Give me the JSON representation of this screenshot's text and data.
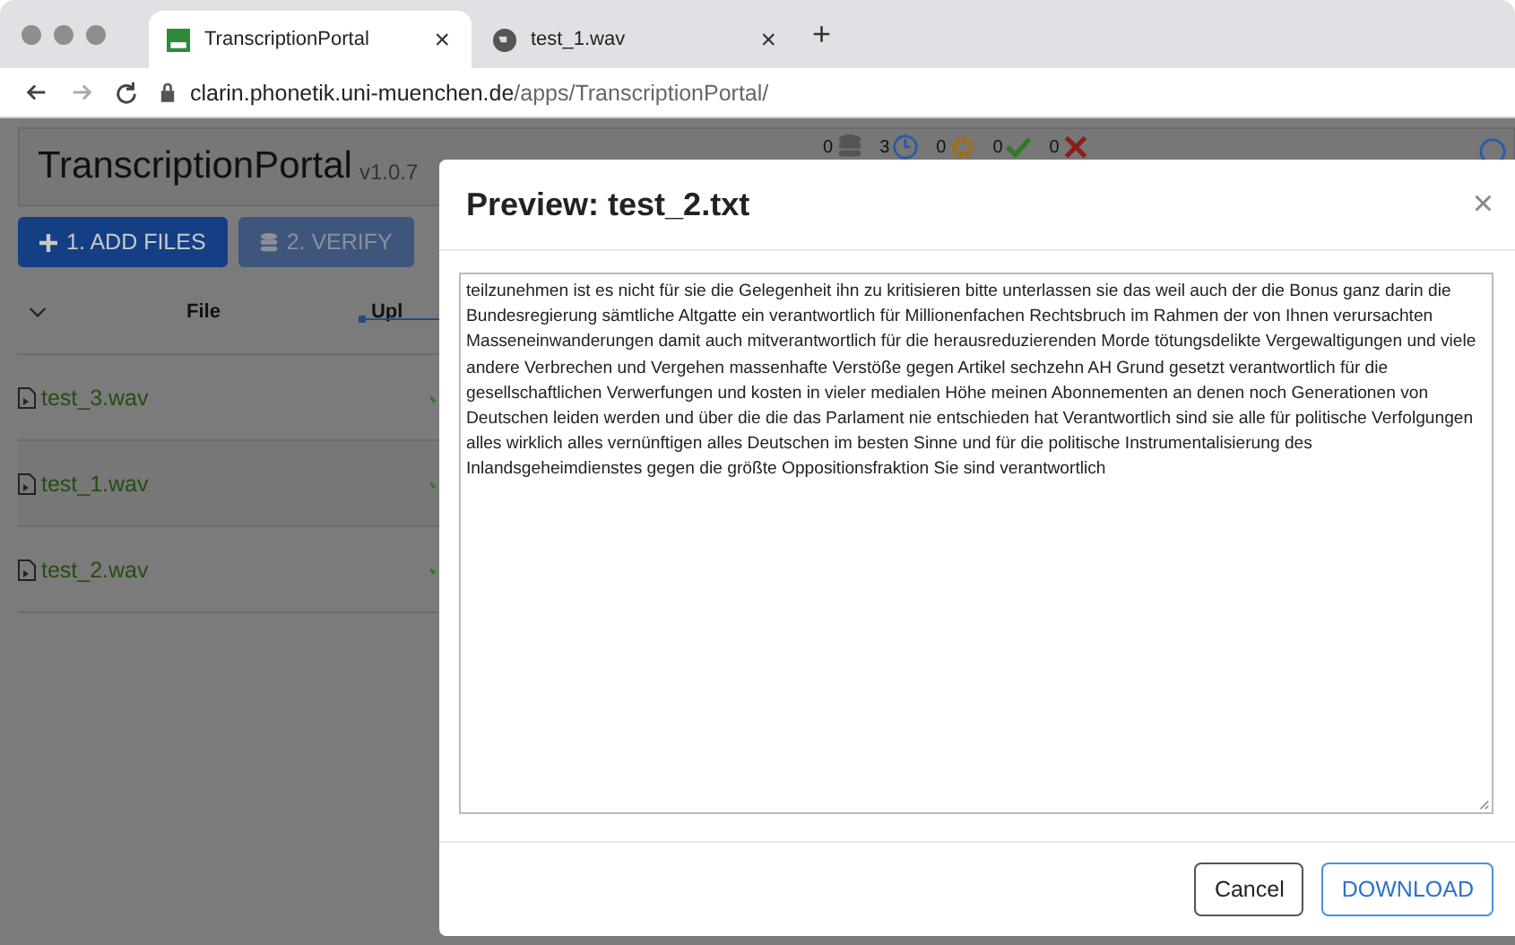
{
  "browser": {
    "tabs": [
      {
        "title": "TranscriptionPortal",
        "selected": true,
        "close": "×"
      },
      {
        "title": "test_1.wav",
        "selected": false,
        "close": "×"
      }
    ],
    "new_tab": "+",
    "address": {
      "host": "clarin.phonetik.uni-muenchen.de",
      "path": "/apps/TranscriptionPortal/"
    }
  },
  "app": {
    "title": "TranscriptionPortal",
    "version": "v1.0.7",
    "status": [
      {
        "count": "0",
        "kind": "database"
      },
      {
        "count": "3",
        "kind": "clock"
      },
      {
        "count": "0",
        "kind": "gear"
      },
      {
        "count": "0",
        "kind": "check"
      },
      {
        "count": "0",
        "kind": "cross"
      }
    ],
    "buttons": [
      {
        "label": "1. ADD FILES",
        "kind": "add",
        "disabled": false
      },
      {
        "label": "2. VERIFY",
        "kind": "verify",
        "disabled": true
      }
    ],
    "columns": [
      {
        "label": "File"
      },
      {
        "label": "Upl"
      }
    ],
    "files": [
      {
        "name": "test_3.wav",
        "uploaded": true
      },
      {
        "name": "test_1.wav",
        "uploaded": true
      },
      {
        "name": "test_2.wav",
        "uploaded": true
      }
    ]
  },
  "modal": {
    "title": "Preview: test_2.txt",
    "close": "×",
    "text": "teilzunehmen ist es nicht für sie die Gelegenheit ihn zu kritisieren bitte unterlassen sie das weil auch der die Bonus ganz darin die Bundesregierung sämtliche Altgatte ein verantwortlich für Millionenfachen Rechtsbruch im Rahmen der von Ihnen verursachten Masseneinwanderungen damit auch mitverantwortlich für die herausreduzierenden Morde tötungsdelikte Vergewaltigungen und viele andere Verbrechen und Vergehen massenhafte Verstöße gegen Artikel sechzehn AH Grund gesetzt verantwortlich für die gesellschaftlichen Verwerfungen und kosten in vieler medialen Höhe meinen Abonnementen an denen noch Generationen von Deutschen leiden werden und über die die das Parlament nie entschieden hat Verantwortlich sind sie alle für politische Verfolgungen alles wirklich alles vernünftigen alles Deutschen im besten Sinne und für die politische Instrumentalisierung des Inlandsgeheimdienstes gegen die größte Oppositionsfraktion Sie sind verantwortlich",
    "buttons": [
      {
        "label": "Cancel",
        "kind": "secondary"
      },
      {
        "label": "DOWNLOAD",
        "kind": "primary"
      }
    ]
  }
}
